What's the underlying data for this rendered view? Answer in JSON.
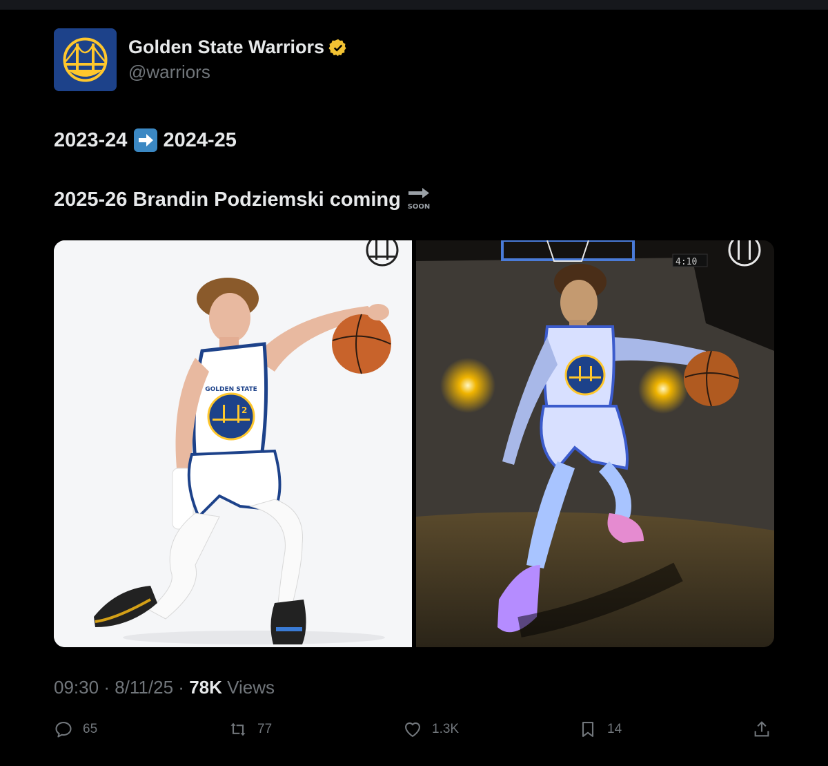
{
  "author": {
    "name": "Golden State Warriors",
    "handle": "@warriors",
    "verified": true,
    "badge_color": "#f2c233"
  },
  "tweet": {
    "line1_part1": "2023-24",
    "line1_part2": "2024-25",
    "line2_text": "2025-26 Brandin Podziemski coming",
    "soon_label": "SOON",
    "emoji": [
      "right-arrow-emoji",
      "soon-arrow-emoji"
    ]
  },
  "media": {
    "photos": [
      {
        "description_icon": "player-photo-white-background"
      },
      {
        "description_icon": "player-photo-dark-stage"
      }
    ],
    "jersey_text": "GOLDEN STATE",
    "jersey_number": "2"
  },
  "meta": {
    "time": "09:30",
    "date": "8/11/25",
    "views_count": "78K",
    "views_label": "Views",
    "separator": "·"
  },
  "actions": {
    "replies": "65",
    "reposts": "77",
    "likes": "1.3K",
    "bookmarks": "14"
  },
  "colors": {
    "background": "#000000",
    "text_primary": "#e7e9ea",
    "text_secondary": "#71767b",
    "warriors_blue": "#1d428a",
    "warriors_gold": "#ffc72c"
  }
}
